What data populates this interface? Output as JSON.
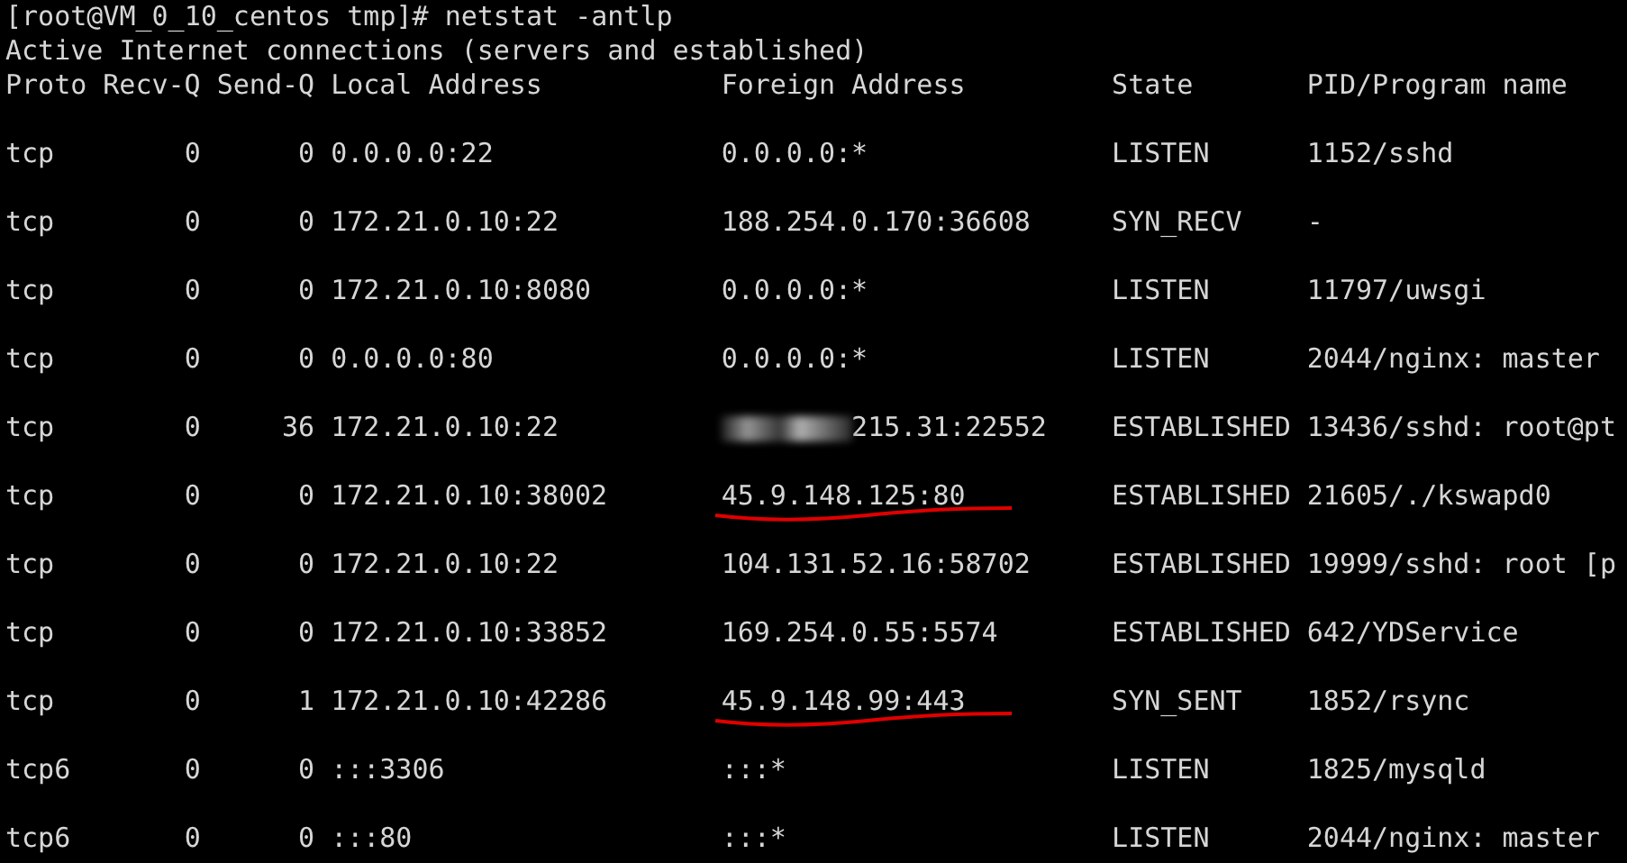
{
  "prompt": "[root@VM_0_10_centos tmp]# netstat -antlp",
  "info": "Active Internet connections (servers and established)",
  "columns": [
    "Proto",
    "Recv-Q",
    "Send-Q",
    "Local Address",
    "Foreign Address",
    "State",
    "PID/Program name"
  ],
  "rows": [
    {
      "proto": "tcp",
      "recv_q": "0",
      "send_q": "0",
      "local_address": "0.0.0.0:22",
      "foreign_address": "0.0.0.0:*",
      "state": "LISTEN",
      "pid_program": "1152/sshd",
      "redacted": false,
      "underlined": false
    },
    {
      "proto": "tcp",
      "recv_q": "0",
      "send_q": "0",
      "local_address": "172.21.0.10:22",
      "foreign_address": "188.254.0.170:36608",
      "state": "SYN_RECV",
      "pid_program": "-",
      "redacted": false,
      "underlined": false
    },
    {
      "proto": "tcp",
      "recv_q": "0",
      "send_q": "0",
      "local_address": "172.21.0.10:8080",
      "foreign_address": "0.0.0.0:*",
      "state": "LISTEN",
      "pid_program": "11797/uwsgi",
      "redacted": false,
      "underlined": false
    },
    {
      "proto": "tcp",
      "recv_q": "0",
      "send_q": "0",
      "local_address": "0.0.0.0:80",
      "foreign_address": "0.0.0.0:*",
      "state": "LISTEN",
      "pid_program": "2044/nginx: master",
      "redacted": false,
      "underlined": false
    },
    {
      "proto": "tcp",
      "recv_q": "0",
      "send_q": "36",
      "local_address": "172.21.0.10:22",
      "foreign_address": "215.31:22552",
      "state": "ESTABLISHED",
      "pid_program": "13436/sshd: root@pt",
      "redacted": true,
      "underlined": false
    },
    {
      "proto": "tcp",
      "recv_q": "0",
      "send_q": "0",
      "local_address": "172.21.0.10:38002",
      "foreign_address": "45.9.148.125:80",
      "state": "ESTABLISHED",
      "pid_program": "21605/./kswapd0",
      "redacted": false,
      "underlined": true
    },
    {
      "proto": "tcp",
      "recv_q": "0",
      "send_q": "0",
      "local_address": "172.21.0.10:22",
      "foreign_address": "104.131.52.16:58702",
      "state": "ESTABLISHED",
      "pid_program": "19999/sshd: root [p",
      "redacted": false,
      "underlined": false
    },
    {
      "proto": "tcp",
      "recv_q": "0",
      "send_q": "0",
      "local_address": "172.21.0.10:33852",
      "foreign_address": "169.254.0.55:5574",
      "state": "ESTABLISHED",
      "pid_program": "642/YDService",
      "redacted": false,
      "underlined": false
    },
    {
      "proto": "tcp",
      "recv_q": "0",
      "send_q": "1",
      "local_address": "172.21.0.10:42286",
      "foreign_address": "45.9.148.99:443",
      "state": "SYN_SENT",
      "pid_program": "1852/rsync",
      "redacted": false,
      "underlined": true
    },
    {
      "proto": "tcp6",
      "recv_q": "0",
      "send_q": "0",
      "local_address": ":::3306",
      "foreign_address": ":::*",
      "state": "LISTEN",
      "pid_program": "1825/mysqld",
      "redacted": false,
      "underlined": false
    },
    {
      "proto": "tcp6",
      "recv_q": "0",
      "send_q": "0",
      "local_address": ":::80",
      "foreign_address": ":::*",
      "state": "LISTEN",
      "pid_program": "2044/nginx: master",
      "redacted": false,
      "underlined": false
    }
  ]
}
